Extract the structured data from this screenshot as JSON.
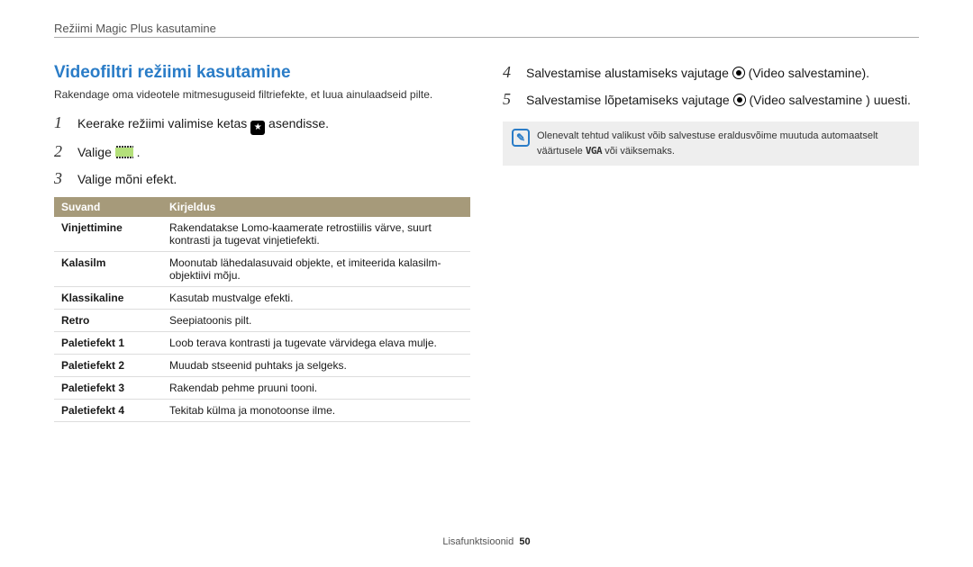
{
  "header": "Režiimi Magic Plus kasutamine",
  "left": {
    "title": "Videofiltri režiimi kasutamine",
    "intro": "Rakendage oma videotele mitmesuguseid filtriefekte, et luua ainulaadseid pilte.",
    "steps": [
      {
        "n": "1",
        "pre": "Keerake režiimi valimise ketas ",
        "icon": "star",
        "post": " asendisse."
      },
      {
        "n": "2",
        "pre": "Valige ",
        "icon": "film",
        "post": " ."
      },
      {
        "n": "3",
        "pre": "Valige mõni efekt.",
        "icon": null,
        "post": ""
      }
    ],
    "table": {
      "th0": "Suvand",
      "th1": "Kirjeldus",
      "rows": [
        {
          "k": "Vinjettimine",
          "v": "Rakendatakse Lomo-kaamerate retrostiilis värve, suurt kontrasti ja tugevat vinjetiefekti."
        },
        {
          "k": "Kalasilm",
          "v": "Moonutab lähedalasuvaid objekte, et imiteerida kalasilm-objektiivi mõju."
        },
        {
          "k": "Klassikaline",
          "v": "Kasutab mustvalge efekti."
        },
        {
          "k": "Retro",
          "v": "Seepiatoonis pilt."
        },
        {
          "k": "Paletiefekt 1",
          "v": "Loob terava kontrasti ja tugevate värvidega elava mulje."
        },
        {
          "k": "Paletiefekt 2",
          "v": "Muudab stseenid puhtaks ja selgeks."
        },
        {
          "k": "Paletiefekt 3",
          "v": "Rakendab pehme pruuni tooni."
        },
        {
          "k": "Paletiefekt 4",
          "v": "Tekitab külma ja monotoonse ilme."
        }
      ]
    }
  },
  "right": {
    "steps": [
      {
        "n": "4",
        "pre": "Salvestamise alustamiseks vajutage ",
        "icon": "rec",
        "post": " (Video salvestamine)."
      },
      {
        "n": "5",
        "pre": "Salvestamise lõpetamiseks vajutage ",
        "icon": "rec",
        "post": " (Video salvestamine ) uuesti."
      }
    ],
    "note_pre": "Olenevalt tehtud valikust võib salvestuse eraldusvõime muutuda automaatselt väärtusele ",
    "note_vga": "VGA",
    "note_post": " või väiksemaks."
  },
  "footer": {
    "label": "Lisafunktsioonid",
    "page": "50"
  }
}
